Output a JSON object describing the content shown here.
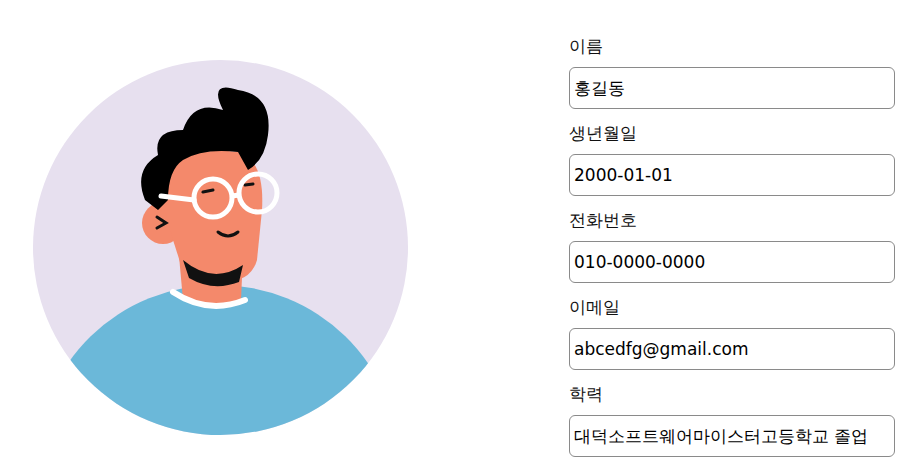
{
  "profile": {
    "fields": [
      {
        "label": "이름",
        "value": "홍길동"
      },
      {
        "label": "생년월일",
        "value": "2000-01-01"
      },
      {
        "label": "전화번호",
        "value": "010-0000-0000"
      },
      {
        "label": "이메일",
        "value": "abcedfg@gmail.com"
      },
      {
        "label": "학력",
        "value": "대덕소프트웨어마이스터고등학교 졸업"
      }
    ]
  }
}
